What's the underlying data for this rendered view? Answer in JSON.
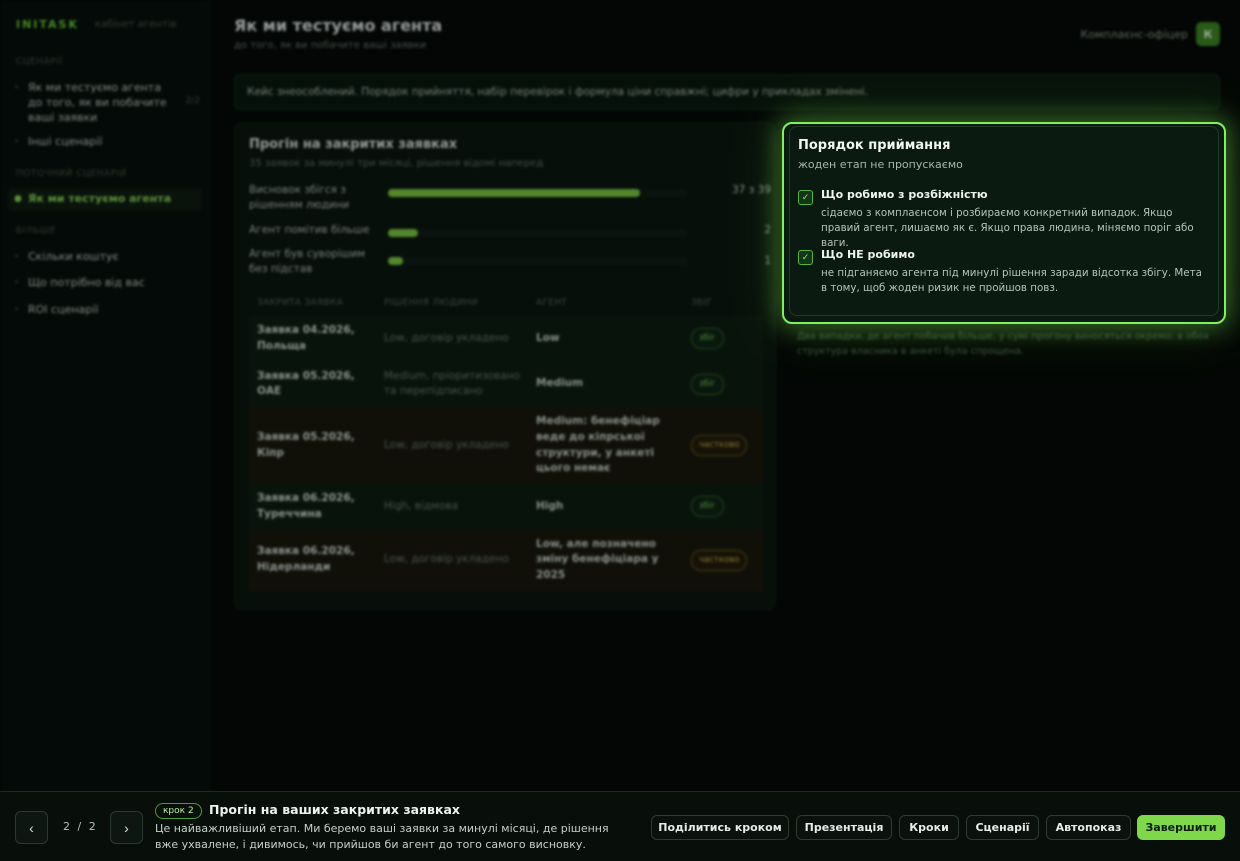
{
  "brand": {
    "name": "INITASK",
    "subtitle": "кабінет агентів"
  },
  "sidebar": {
    "section_scenarios": "сценарії",
    "items_top": [
      {
        "label": "Як ми тестуємо агента до того, як ви побачите ваші заявки",
        "meta": "2/2"
      },
      {
        "label": "Інші сценарії"
      }
    ],
    "section_current": "поточний сценарій",
    "active_item": "Як ми тестуємо агента",
    "section_more": "більше",
    "items_bottom": [
      {
        "label": "Скільки коштує"
      },
      {
        "label": "Що потрібно від вас"
      },
      {
        "label": "ROI сценарії"
      }
    ]
  },
  "header": {
    "title": "Як ми тестуємо агента",
    "subtitle": "до того, як ви побачите ваші заявки"
  },
  "user": {
    "name": "Комплаєнс-офіцер",
    "initial": "К"
  },
  "notice": "Кейс знеособлений. Порядок прийняття, набір перевірок і формула ціни справжні; цифри у прикладах змінені.",
  "card": {
    "title": "Прогін на закритих заявках",
    "subtitle": "35 заявок за минулі три місяці, рішення відомі наперед",
    "bars": [
      {
        "label": "Висновок збігся з рішенням людини",
        "value": "37 з 39",
        "ratio": 0.84
      },
      {
        "label": "Агент помітив більше",
        "value": "2",
        "ratio": 0.1
      },
      {
        "label": "Агент був суворішим без підстав",
        "value": "1",
        "ratio": 0.05
      }
    ],
    "table": {
      "headers": [
        "ЗАКРИТА ЗАЯВКА",
        "РІШЕННЯ ЛЮДИНИ",
        "АГЕНТ",
        "ЗБІГ"
      ],
      "rows": [
        {
          "id": "Заявка 04.2026, Польща",
          "input": "Low, договір укладено",
          "agent": "Low",
          "match": "збіг",
          "status": "ok"
        },
        {
          "id": "Заявка 05.2026, ОАЕ",
          "input": "Medium, пріоритизовано та перепідписано",
          "agent": "Medium",
          "match": "збіг",
          "status": "ok"
        },
        {
          "id": "Заявка 05.2026, Кіпр",
          "input": "Low, договір укладено",
          "agent": "Medium: бенефіціар веде до кіпрської структури, у анкеті цього немає",
          "match": "частково",
          "status": "part"
        },
        {
          "id": "Заявка 06.2026, Туреччина",
          "input": "High, відмова",
          "agent": "High",
          "match": "збіг",
          "status": "ok"
        },
        {
          "id": "Заявка 06.2026, Нідерланди",
          "input": "Low, договір укладено",
          "agent": "Low, але позначено зміну бенефіціара у 2025",
          "match": "частково",
          "status": "part"
        }
      ]
    }
  },
  "annotation": "Два випадки, де агент побачив більше, у сумі прогону виносяться окремо: в обох структура власника в анкеті була спрощена.",
  "spotlight": {
    "title": "Порядок приймання",
    "subtitle": "жоден етап не пропускаємо",
    "rules": [
      {
        "title": "Що робимо з розбіжністю",
        "desc": "сідаємо з комплаєнсом і розбираємо конкретний випадок. Якщо правий агент, лишаємо як є. Якщо права людина, міняємо поріг або ваги."
      },
      {
        "title": "Що НЕ робимо",
        "desc": "не підганяємо агента під минулі рішення заради відсотка збігу. Мета в тому, щоб жоден ризик не пройшов повз."
      }
    ]
  },
  "bottom": {
    "prev": "‹",
    "next": "›",
    "page_current": "2",
    "page_sep": "/",
    "page_total": "2",
    "step_badge": "крок 2",
    "step_title": "Прогін на ваших закритих заявках",
    "step_desc": "Це найважливіший етап. Ми беремо ваші заявки за минулі місяці, де рішення вже ухвалене, і дивимось, чи прийшов би агент до того самого висновку. Розбіжності…",
    "buttons": {
      "share": "Поділитись кроком",
      "present": "Презентація",
      "steps": "Кроки",
      "scenarios": "Сценарії",
      "autoplay": "Автопоказ",
      "finish": "Завершити"
    }
  },
  "colors": {
    "accent": "#7fd84a",
    "glow": "#7ef25a",
    "warn": "#d8b44d"
  }
}
